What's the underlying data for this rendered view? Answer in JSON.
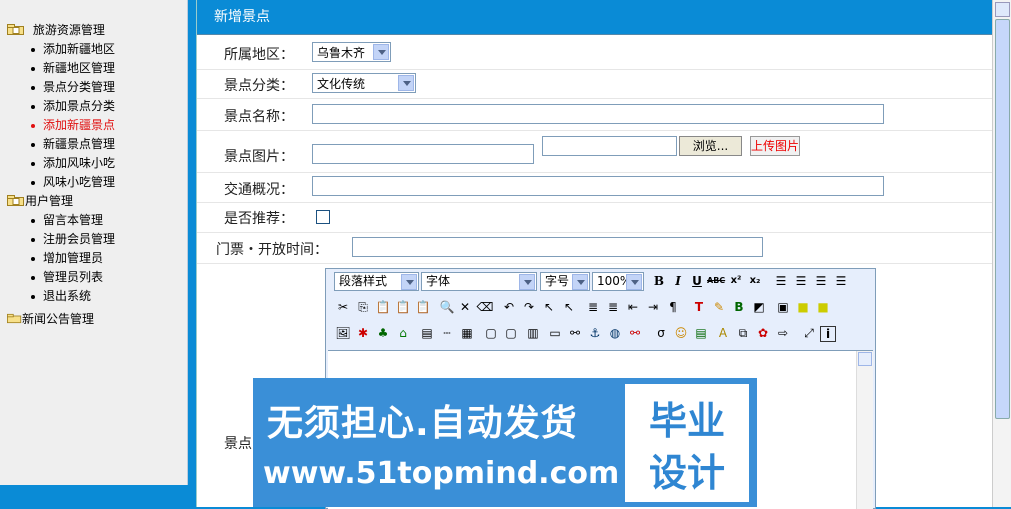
{
  "sidebar": {
    "groups": [
      {
        "label": "旅游资源管理",
        "items": [
          "添加新疆地区",
          "新疆地区管理",
          "景点分类管理",
          "添加景点分类",
          "添加新疆景点",
          "新疆景点管理",
          "添加风味小吃",
          "风味小吃管理"
        ]
      },
      {
        "label": "用户管理",
        "items": [
          "留言本管理",
          "注册会员管理",
          "增加管理员",
          "管理员列表",
          "退出系统"
        ]
      },
      {
        "label": "新闻公告管理",
        "items": []
      }
    ]
  },
  "form": {
    "title": "新增景点",
    "region_label": "所属地区：",
    "region_value": "乌鲁木齐",
    "category_label": "景点分类：",
    "category_value": "文化传统",
    "name_label": "景点名称：",
    "image_label": "景点图片：",
    "browse_label": "浏览...",
    "upload_label": "上传图片",
    "traffic_label": "交通概况：",
    "recommend_label": "是否推荐：",
    "ticket_label": "门票・开放时间：",
    "intro_label": "景点"
  },
  "editor": {
    "paragraph_style": "段落样式",
    "font": "字体",
    "font_size": "字号",
    "zoom": "100%",
    "toolbar_row1": [
      "bold-icon",
      "italic-icon",
      "underline-icon",
      "strikethrough-icon",
      "superscript-icon",
      "subscript-icon",
      "align-left-icon",
      "align-center-icon",
      "align-right-icon",
      "align-justify-icon"
    ],
    "toolbar_row2": [
      "cut-icon",
      "copy-icon",
      "paste-icon",
      "paste-text-icon",
      "paste-word-icon",
      "find-icon",
      "delete-icon",
      "eraser-icon",
      "undo-icon",
      "redo-icon",
      "select-icon",
      "pointer-icon",
      "ordered-list-icon",
      "unordered-list-icon",
      "outdent-icon",
      "indent-icon",
      "paragraph-icon",
      "text-color-icon",
      "highlight-icon",
      "background-color-icon",
      "table-border-icon",
      "box-icon",
      "yellow-box-icon",
      "yellow-box2-icon"
    ],
    "toolbar_row3": [
      "image-icon",
      "flash-icon",
      "media-icon",
      "home-icon",
      "form-icon",
      "line-icon",
      "table-icon",
      "doc-icon",
      "page-icon",
      "separator-icon",
      "button-icon",
      "link-icon",
      "anchor-icon",
      "globe-icon",
      "unlink-icon",
      "special-char-icon",
      "emoticon-icon",
      "chart-icon",
      "abc-icon",
      "copy-format-icon",
      "bug-icon",
      "export-icon",
      "fullscreen-icon",
      "info-icon"
    ]
  },
  "watermark": {
    "line1": "无须担心.自动发货",
    "line2": "www.51topmind.com",
    "badge1": "毕业",
    "badge2": "设计"
  },
  "colors": {
    "accent": "#0a8bd6",
    "active_item": "#e01010"
  }
}
